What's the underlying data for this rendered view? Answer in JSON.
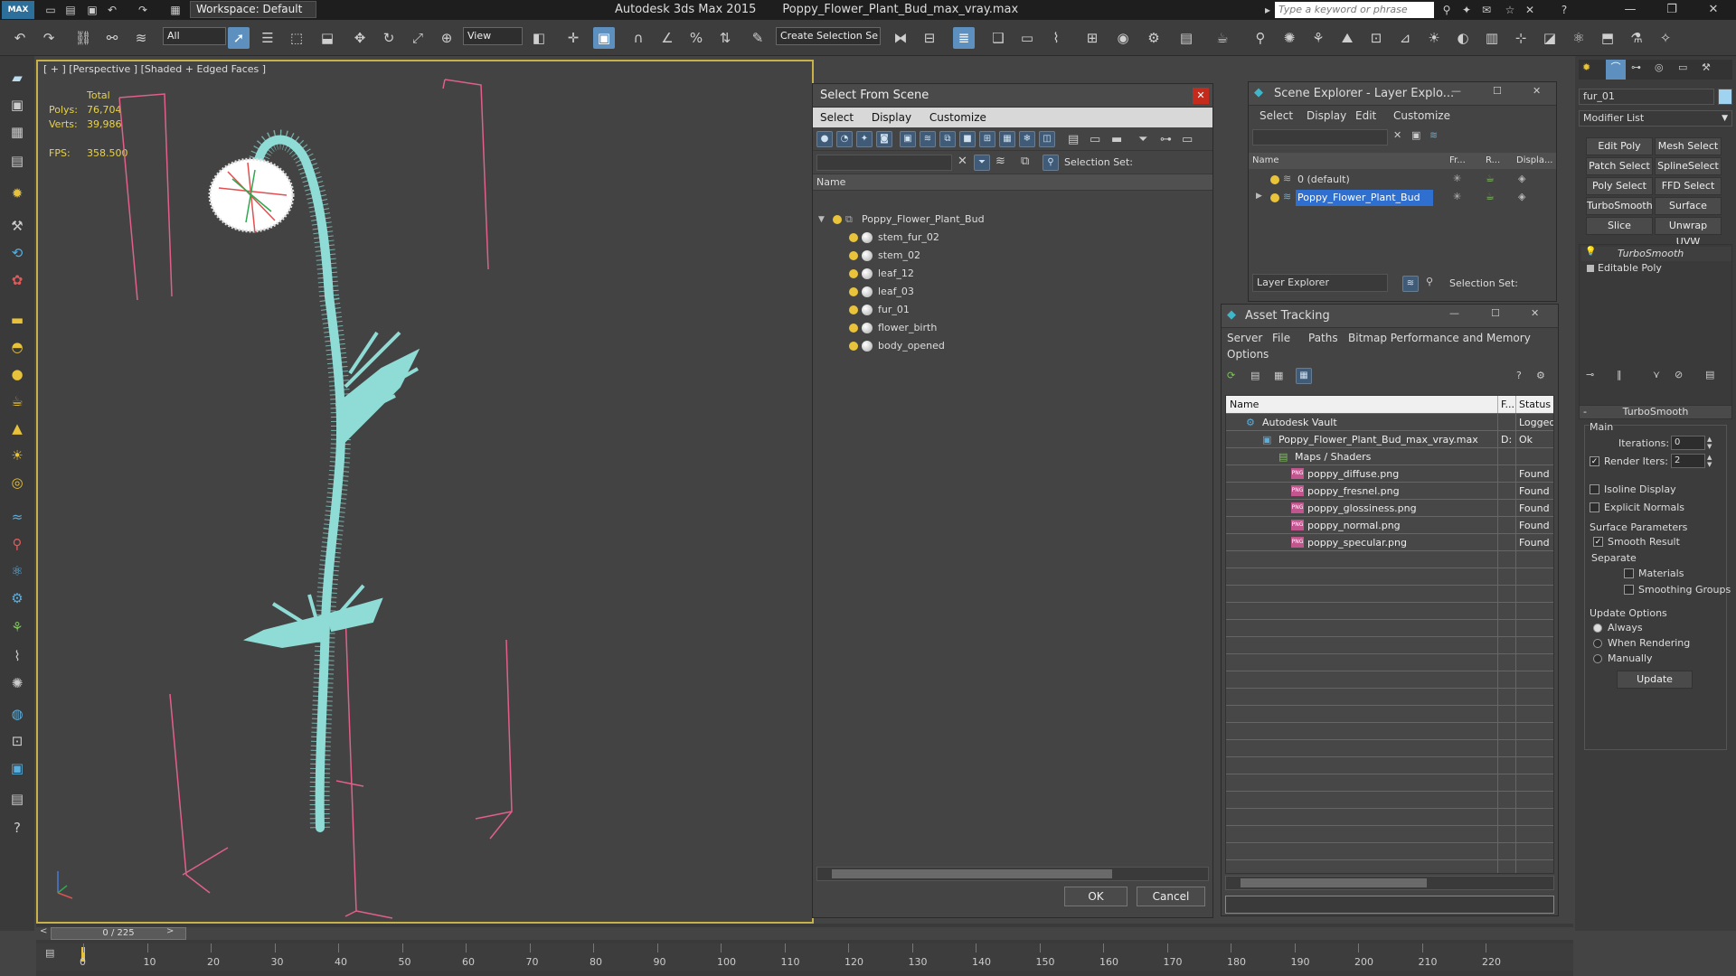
{
  "titlebar": {
    "logo": "MAX",
    "workspace": "Workspace: Default",
    "app_name": "Autodesk 3ds Max  2015",
    "file_name": "Poppy_Flower_Plant_Bud_max_vray.max",
    "search_placeholder": "Type a keyword or phrase"
  },
  "toolbar": {
    "filter_select": "All",
    "refcoord_select": "View",
    "selection_set": "Create Selection Se"
  },
  "viewport": {
    "label": "[ + ] [Perspective ] [Shaded + Edged Faces ]",
    "stats": {
      "total_label": "Total",
      "polys_label": "Polys:",
      "polys_value": "76,704",
      "verts_label": "Verts:",
      "verts_value": "39,986",
      "fps_label": "FPS:",
      "fps_value": "358.500"
    }
  },
  "select_from_scene": {
    "title": "Select From Scene",
    "menu": [
      "Select",
      "Display",
      "Customize"
    ],
    "selection_set_label": "Selection Set:",
    "column_name": "Name",
    "root": "Poppy_Flower_Plant_Bud",
    "children": [
      "stem_fur_02",
      "stem_02",
      "leaf_12",
      "leaf_03",
      "fur_01",
      "flower_birth",
      "body_opened"
    ],
    "ok_label": "OK",
    "cancel_label": "Cancel"
  },
  "scene_explorer": {
    "title": "Scene Explorer - Layer Explo...",
    "menu": [
      "Select",
      "Display",
      "Edit",
      "Customize"
    ],
    "col_name": "Name",
    "col_fr": "Fr...",
    "col_r": "R...",
    "col_disp": "Displa...",
    "layers": [
      "0 (default)",
      "Poppy_Flower_Plant_Bud"
    ],
    "footer_select": "Layer Explorer",
    "footer_selset": "Selection Set:"
  },
  "asset_tracking": {
    "title": "Asset Tracking",
    "menu": [
      "Server",
      "File",
      "Paths",
      "Bitmap Performance and Memory",
      "Options"
    ],
    "col_name": "Name",
    "col_f": "F...",
    "col_status": "Status",
    "rows": [
      {
        "name": "Autodesk Vault",
        "f": "",
        "status": "Logged"
      },
      {
        "name": "Poppy_Flower_Plant_Bud_max_vray.max",
        "f": "D:",
        "status": "Ok"
      },
      {
        "name": "Maps / Shaders",
        "f": "",
        "status": ""
      },
      {
        "name": "poppy_diffuse.png",
        "f": "",
        "status": "Found"
      },
      {
        "name": "poppy_fresnel.png",
        "f": "",
        "status": "Found"
      },
      {
        "name": "poppy_glossiness.png",
        "f": "",
        "status": "Found"
      },
      {
        "name": "poppy_normal.png",
        "f": "",
        "status": "Found"
      },
      {
        "name": "poppy_specular.png",
        "f": "",
        "status": "Found"
      }
    ]
  },
  "command_panel": {
    "object_name": "fur_01",
    "modifier_list": "Modifier List",
    "buttons": [
      "Edit Poly",
      "Mesh Select",
      "Patch Select",
      "SplineSelect",
      "Poly Select",
      "FFD Select",
      "TurboSmooth",
      "Surface Select",
      "Slice",
      "Unwrap UVW"
    ],
    "stack": [
      "TurboSmooth",
      "Editable Poly"
    ],
    "rollout_title": "TurboSmooth",
    "main_label": "Main",
    "iterations_label": "Iterations:",
    "iterations_value": "0",
    "render_iters_label": "Render Iters:",
    "render_iters_value": "2",
    "isoline_label": "Isoline Display",
    "explicit_normals_label": "Explicit Normals",
    "surface_params_label": "Surface Parameters",
    "smooth_result_label": "Smooth Result",
    "separate_label": "Separate",
    "materials_label": "Materials",
    "smoothing_groups_label": "Smoothing Groups",
    "update_options_label": "Update Options",
    "always_label": "Always",
    "when_rendering_label": "When Rendering",
    "manually_label": "Manually",
    "update_button": "Update"
  },
  "timeline": {
    "frame_counter": "0 / 225",
    "ticks": [
      "0",
      "10",
      "20",
      "30",
      "40",
      "50",
      "60",
      "70",
      "80",
      "90",
      "100",
      "110",
      "120",
      "130",
      "140",
      "150",
      "160",
      "170",
      "180",
      "190",
      "200",
      "210",
      "220"
    ]
  },
  "colors": {
    "accent": "#5d8fbf",
    "viewport_border": "#c9b14a",
    "plant": "#8fdcd6",
    "bbox": "#e0608a",
    "stats_text": "#e8d34a",
    "selected_row": "#2f6fd0"
  }
}
